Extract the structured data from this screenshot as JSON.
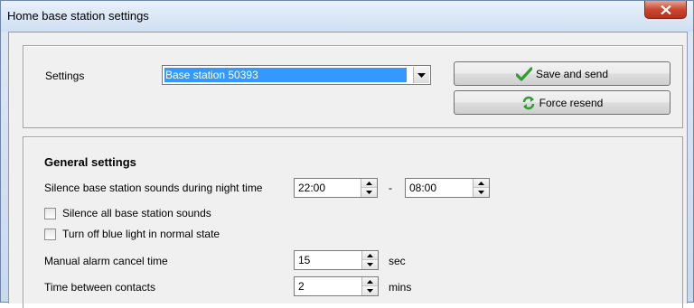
{
  "window": {
    "title": "Home base station settings"
  },
  "top": {
    "settings_label": "Settings",
    "selected_station": "Base station 50393",
    "save_button": "Save and send",
    "force_button": "Force resend"
  },
  "general": {
    "heading": "General settings",
    "silence_label": "Silence base station sounds during night time",
    "night_start": "22:00",
    "range_dash": "-",
    "night_end": "08:00",
    "silence_all_label": "Silence all base station sounds",
    "blue_light_label": "Turn off blue light in normal state",
    "cancel_label": "Manual alarm cancel time",
    "cancel_value": "15",
    "cancel_unit": "sec",
    "contacts_label": "Time between contacts",
    "contacts_value": "2",
    "contacts_unit": "mins"
  },
  "icons": {
    "save": "green-check-icon",
    "force": "green-refresh-icon",
    "close": "close-x-icon"
  }
}
